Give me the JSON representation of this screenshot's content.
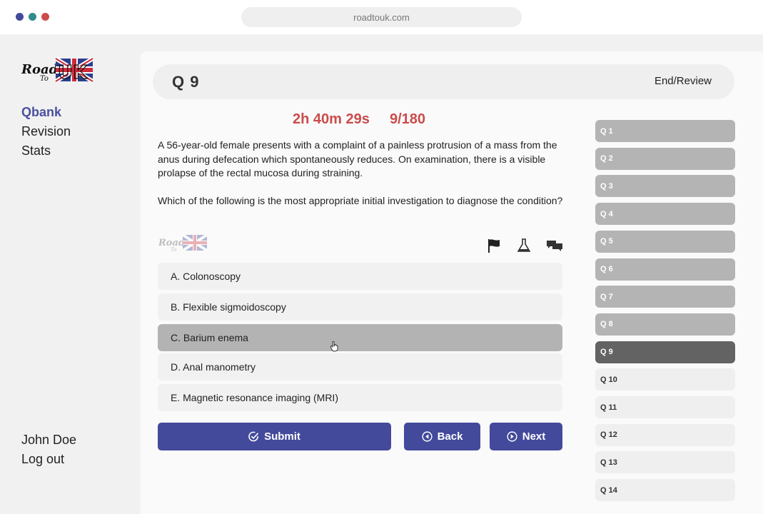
{
  "browser": {
    "url": "roadtouk.com",
    "dots": [
      "#434a9b",
      "#2f8c8c",
      "#cc4b4b"
    ]
  },
  "sidebar": {
    "logo_text": "Road To UK",
    "nav": [
      {
        "label": "Qbank",
        "active": true
      },
      {
        "label": "Revision",
        "active": false
      },
      {
        "label": "Stats",
        "active": false
      }
    ],
    "user_name": "John Doe",
    "logout_label": "Log out"
  },
  "header": {
    "title": "Q 9",
    "end_review_label": "End/Review"
  },
  "timer": {
    "time": "2h 40m 29s",
    "progress": "9/180"
  },
  "question": {
    "stem": "A 56-year-old female presents with a complaint of a painless protrusion of a mass from the anus during defecation which spontaneously reduces. On examination, there is a visible prolapse of the rectal mucosa during straining.",
    "prompt": "Which of the following is the most appropriate initial investigation to diagnose the condition?",
    "options": [
      {
        "label": "A. Colonoscopy",
        "selected": false
      },
      {
        "label": "B. Flexible sigmoidoscopy",
        "selected": false
      },
      {
        "label": "C. Barium enema",
        "selected": true
      },
      {
        "label": "D. Anal manometry",
        "selected": false
      },
      {
        "label": "E. Magnetic resonance imaging (MRI)",
        "selected": false
      }
    ]
  },
  "tools": [
    "flag-icon",
    "lab-flask-icon",
    "comments-icon"
  ],
  "buttons": {
    "submit": "Submit",
    "back": "Back",
    "next": "Next"
  },
  "question_list": [
    {
      "label": "Q 1",
      "status": "answered"
    },
    {
      "label": "Q 2",
      "status": "answered"
    },
    {
      "label": "Q 3",
      "status": "answered"
    },
    {
      "label": "Q 4",
      "status": "answered"
    },
    {
      "label": "Q 5",
      "status": "answered"
    },
    {
      "label": "Q 6",
      "status": "answered"
    },
    {
      "label": "Q 7",
      "status": "answered"
    },
    {
      "label": "Q 8",
      "status": "answered"
    },
    {
      "label": "Q 9",
      "status": "current"
    },
    {
      "label": "Q 10",
      "status": "unanswered"
    },
    {
      "label": "Q 11",
      "status": "unanswered"
    },
    {
      "label": "Q 12",
      "status": "unanswered"
    },
    {
      "label": "Q 13",
      "status": "unanswered"
    },
    {
      "label": "Q 14",
      "status": "unanswered"
    }
  ],
  "colors": {
    "accent": "#434a9b",
    "timer": "#cc4b4b",
    "selected_option": "#b3b3b3",
    "current_question": "#636363"
  }
}
